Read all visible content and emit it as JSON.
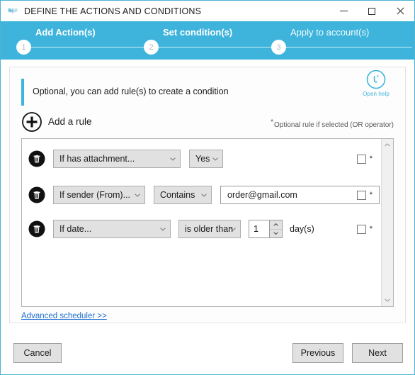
{
  "window": {
    "title": "DEFINE THE ACTIONS AND CONDITIONS",
    "icon": "butterfly-icon",
    "controls": {
      "minimize": "minimize-icon",
      "maximize": "maximize-icon",
      "close": "close-icon"
    }
  },
  "stepper": {
    "steps": [
      {
        "number": "1",
        "label": "Add Action(s)",
        "state": "active"
      },
      {
        "number": "2",
        "label": "Set condition(s)",
        "state": "active"
      },
      {
        "number": "3",
        "label": "Apply to account(s)",
        "state": "inactive"
      }
    ]
  },
  "notice": {
    "text": "Optional, you can add rule(s) to create a condition",
    "accent_color": "#3eb4dc"
  },
  "help": {
    "icon": "help-circle-icon",
    "label": "Open help"
  },
  "add_rule": {
    "icon": "plus-circle-icon",
    "label": "Add a rule"
  },
  "optional_note": {
    "asterisk": "*",
    "text": "Optional rule if selected (OR operator)"
  },
  "rules": [
    {
      "delete_icon": "trash-icon",
      "field": "If has attachment...",
      "field_width": 180,
      "operator": "Yes",
      "operator_width": 48,
      "value": null,
      "value_width": 0,
      "units": null,
      "optional_checked": false,
      "optional_star": "*"
    },
    {
      "delete_icon": "trash-icon",
      "field": "If sender (From)...",
      "field_width": 130,
      "operator": "Contains",
      "operator_width": 82,
      "value": "order@gmail.com",
      "value_width": 225,
      "units": null,
      "optional_checked": false,
      "optional_star": "*"
    },
    {
      "delete_icon": "trash-icon",
      "field": "If date...",
      "field_width": 166,
      "operator": "is older than",
      "operator_width": 88,
      "value": "1",
      "value_width": 0,
      "units": "day(s)",
      "optional_checked": false,
      "optional_star": "*"
    }
  ],
  "scrollbar": {
    "up_arrow": "chevron-up-icon",
    "down_arrow": "chevron-down-icon"
  },
  "advanced_link": {
    "text": "Advanced scheduler >>"
  },
  "footer": {
    "cancel": "Cancel",
    "previous": "Previous",
    "next": "Next"
  },
  "colors": {
    "brand": "#3eb4dc",
    "link": "#1f6fd0",
    "button_face": "#e1e1e1"
  }
}
